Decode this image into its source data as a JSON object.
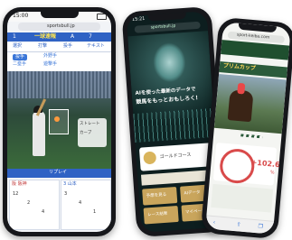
{
  "phone1": {
    "status_time": "15:00",
    "address": "sportsbull.jp",
    "score_row": [
      "1",
      "一球速報",
      "A",
      "7",
      "1"
    ],
    "tab_row": [
      "選択",
      "打撃",
      "投手",
      "テキスト"
    ],
    "field_tags": [
      "投手",
      "外野手",
      "二塁手",
      "遊撃手"
    ],
    "pitch_labels": [
      "ストレート",
      "カーブ"
    ],
    "replay_label": "リプレイ",
    "footer_left_title": "阪 阪神",
    "footer_right_title": "3 山本",
    "stats_left": [
      "12",
      "2",
      "4"
    ],
    "stats_right": [
      "3",
      "4",
      "1"
    ]
  },
  "phone2": {
    "status_time": "15:21",
    "address": "sportsbull.jp",
    "headline_line1": "AIを使った最新のデータで",
    "headline_line2": "競馬をもっとおもしろく!",
    "course_label": "ゴールドコース",
    "menu": [
      "予想を見る",
      "AIデータ",
      "レース結果",
      "マイページ"
    ]
  },
  "phone3": {
    "address": "sport-keiba.com",
    "race_title": "プリムカップ",
    "result_value": "+102.6",
    "result_unit": "%"
  }
}
